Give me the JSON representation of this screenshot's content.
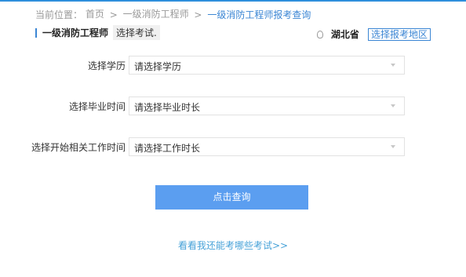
{
  "breadcrumb": {
    "prefix": "当前位置：",
    "items": [
      "首页",
      "一级消防工程师",
      "一级消防工程师报考查询"
    ],
    "separator": ">"
  },
  "header": {
    "exam_name": "一级消防工程师",
    "choose_exam": "选择考试.",
    "region_name": "湖北省",
    "choose_region": "选择报考地区"
  },
  "form": {
    "education": {
      "label": "选择学历",
      "value": "请选择学历"
    },
    "graduation": {
      "label": "选择毕业时间",
      "value": "请选择毕业时长"
    },
    "work_start": {
      "label": "选择开始相关工作时间",
      "value": "请选择工作时长"
    },
    "submit_label": "点击查询"
  },
  "more_link": "看看我还能考哪些考试>>",
  "colors": {
    "accent": "#3b86d4",
    "button": "#5b9ef0",
    "link": "#47a2d8"
  }
}
